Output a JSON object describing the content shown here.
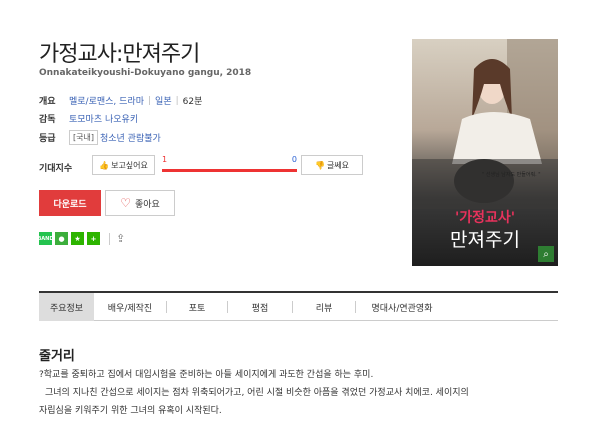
{
  "movie": {
    "title": "가정교사:만져주기",
    "subtitle": "Onnakateikyoushi-Dokuyano gangu, 2018"
  },
  "info": {
    "overview_label": "개요",
    "genre": "멜로/로맨스, 드라마",
    "sep": "|",
    "country": "일본",
    "runtime": "62분",
    "director_label": "감독",
    "director": "토모마츠 나오유키",
    "rating_label": "등급",
    "rating_prefix": "[국내]",
    "rating": "청소년 관람불가"
  },
  "expect": {
    "label": "기대지수",
    "want_button": "보고싶어요",
    "want_count": "1",
    "nah_count": "0",
    "nah_button": "글쎄요"
  },
  "actions": {
    "download": "다운로드",
    "like": "좋아요"
  },
  "share": {
    "icons": [
      "band-icon",
      "kakaostory-icon",
      "star-icon",
      "plus-icon"
    ],
    "band_text": "BAND"
  },
  "poster": {
    "text1": "'가정교사'",
    "text2": "만져주기",
    "quote": "\" 선생님 남자도 만들어줘. \""
  },
  "tabs": [
    "주요정보",
    "배우/제작진",
    "포토",
    "평점",
    "리뷰",
    "명대사/연관영화"
  ],
  "synopsis": {
    "heading": "줄거리",
    "line1": "?학교를 중퇴하고 집에서 대입시험을 준비하는 아들 세이지에게 과도한 간섭을 하는 후미.",
    "line2": "그녀의 지나친 간섭으로 세이지는 점차 위축되어가고, 어린 시절 비슷한 아픔을 겪었던 가정교사 치에코. 세이지의",
    "line3": "자립심을 키워주기 위한 그녀의 유혹이 시작된다."
  },
  "colors": {
    "accent_red": "#e13c3c",
    "link_blue": "#3a62b5"
  }
}
